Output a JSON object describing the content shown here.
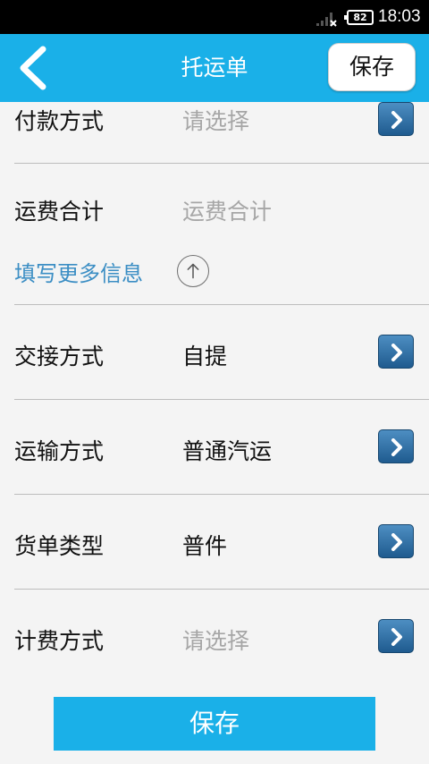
{
  "status_bar": {
    "battery": "82",
    "time": "18:03"
  },
  "header": {
    "title": "托运单",
    "save_label": "保存"
  },
  "form": {
    "payment": {
      "label": "付款方式",
      "value": "请选择"
    },
    "freight_total": {
      "label": "运费合计",
      "value": "运费合计"
    },
    "more_info": {
      "label": "填写更多信息"
    },
    "handover": {
      "label": "交接方式",
      "value": "自提"
    },
    "transport": {
      "label": "运输方式",
      "value": "普通汽运"
    },
    "cargo_type": {
      "label": "货单类型",
      "value": "普件"
    },
    "billing": {
      "label": "计费方式",
      "value": "请选择"
    }
  },
  "footer": {
    "save_label": "保存"
  },
  "colors": {
    "accent": "#1ab0e8",
    "link": "#3b8ec4",
    "chevron": "#2f6fa7",
    "placeholder": "#a6a6a6"
  }
}
